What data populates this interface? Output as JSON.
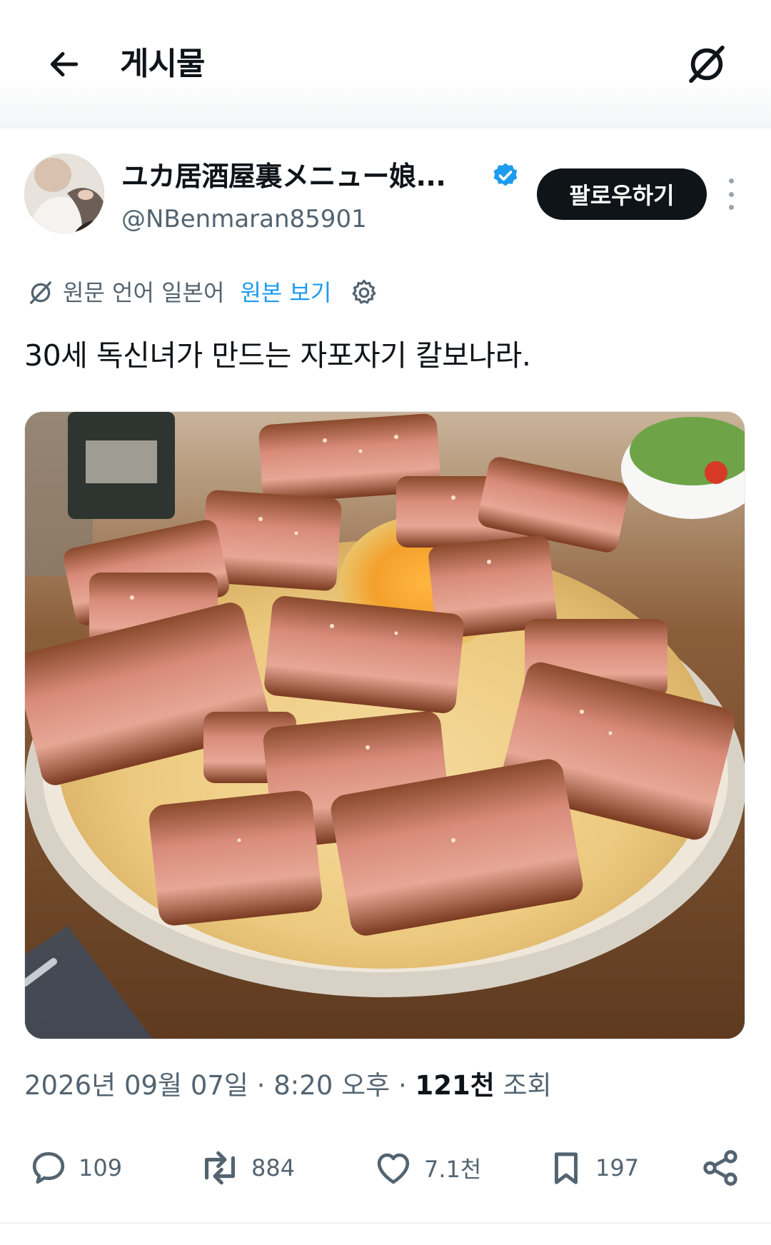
{
  "header": {
    "title": "게시물"
  },
  "author": {
    "display_name": "ユカ居酒屋裏メニュー娘...",
    "handle": "@NBenmaran85901",
    "verified": true,
    "follow_label": "팔로우하기"
  },
  "translation": {
    "source_language": "원문 언어 일본어",
    "view_original": "원본 보기"
  },
  "post": {
    "text": "30세 독신녀가 만드는 자포자기 칼보나라."
  },
  "meta": {
    "date": "2026년 09월 07일",
    "separator1": " · ",
    "time": "8:20 오후",
    "separator2": " · ",
    "views_count": "121천",
    "views_label": " 조회"
  },
  "actions": {
    "replies": "109",
    "reposts": "884",
    "likes": "7.1천",
    "bookmarks": "197"
  },
  "colors": {
    "accent": "#1d9bf0",
    "text_primary": "#0f1419",
    "text_secondary": "#536471",
    "follow_bg": "#0f1419"
  },
  "icons": [
    "arrow-left-icon",
    "translate-icon",
    "verified-badge-icon",
    "more-icon",
    "gear-icon",
    "reply-icon",
    "repost-icon",
    "like-icon",
    "bookmark-icon",
    "share-icon"
  ]
}
